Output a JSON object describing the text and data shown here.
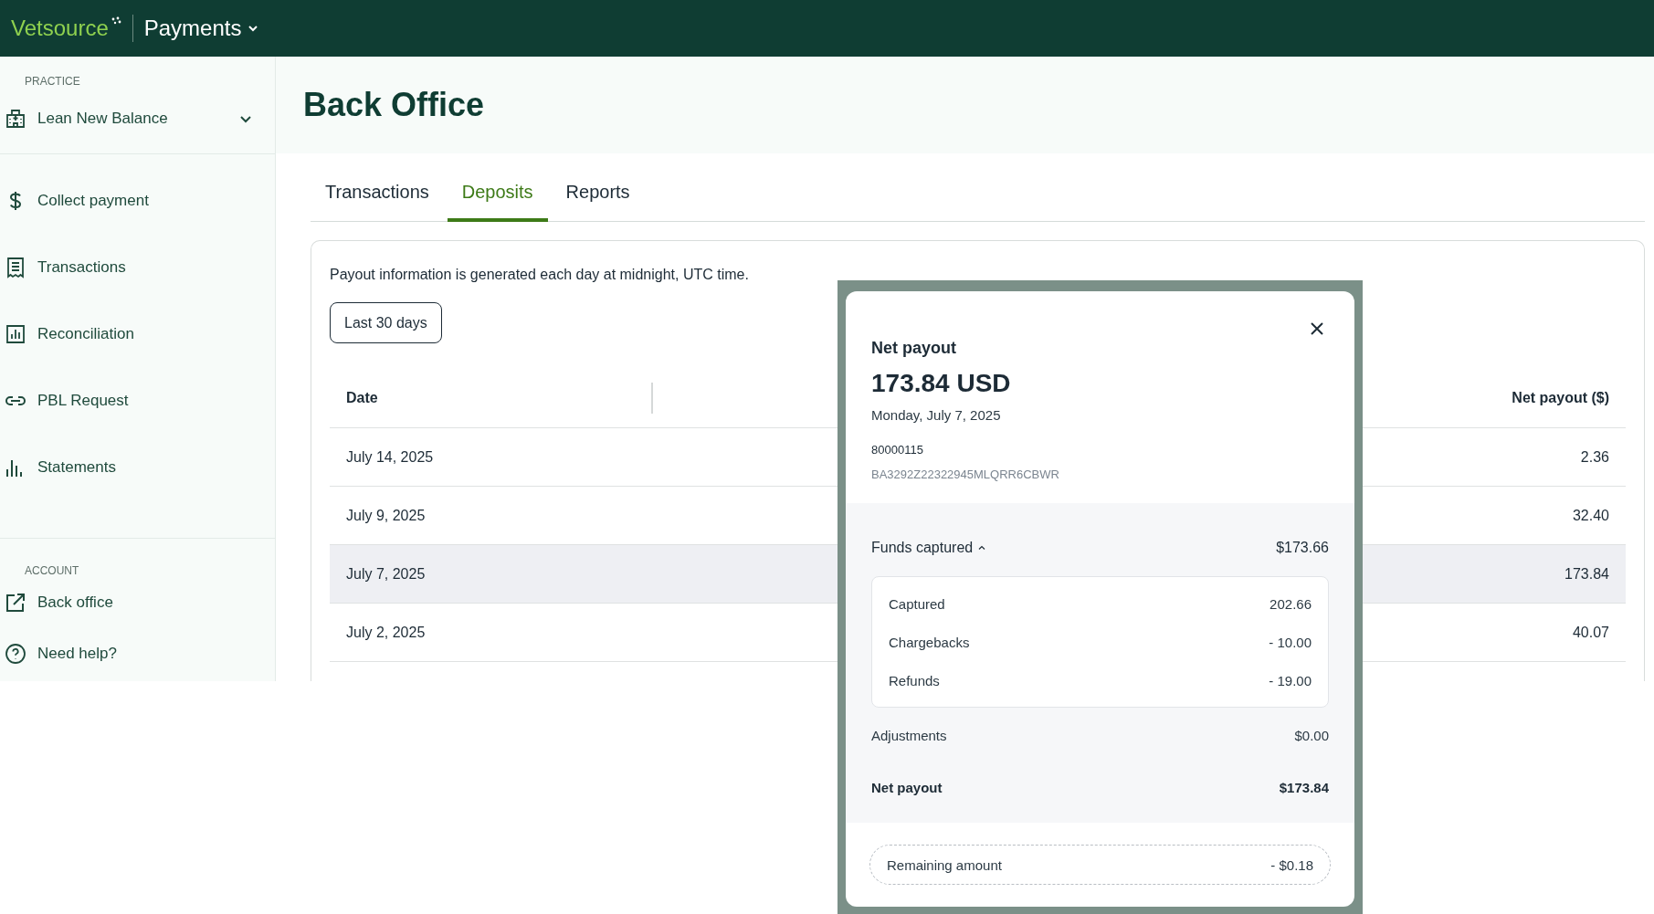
{
  "header": {
    "logo": "Vetsource",
    "app_switcher": "Payments"
  },
  "sidebar": {
    "practice_label": "PRACTICE",
    "practice_selector": "Lean New Balance",
    "nav_items": [
      {
        "label": "Collect payment"
      },
      {
        "label": "Transactions"
      },
      {
        "label": "Reconciliation"
      },
      {
        "label": "PBL Request"
      },
      {
        "label": "Statements"
      }
    ],
    "account_label": "ACCOUNT",
    "account_items": [
      {
        "label": "Back office"
      },
      {
        "label": "Need help?"
      }
    ]
  },
  "page_title": "Back Office",
  "tabs": [
    {
      "label": "Transactions",
      "selected": false
    },
    {
      "label": "Deposits",
      "selected": true
    },
    {
      "label": "Reports",
      "selected": false
    }
  ],
  "card": {
    "info_text": "Payout information is generated each day at midnight, UTC time.",
    "filter_button": "Last 30 days",
    "table": {
      "columns": [
        "Date",
        "Net payout ($)"
      ],
      "rows": [
        {
          "date": "July 14, 2025",
          "net_payout": "2.36",
          "highlighted": false
        },
        {
          "date": "July 9, 2025",
          "net_payout": "32.40",
          "highlighted": false
        },
        {
          "date": "July 7, 2025",
          "net_payout": "173.84",
          "highlighted": true
        },
        {
          "date": "July 2, 2025",
          "net_payout": "40.07",
          "highlighted": false
        }
      ]
    }
  },
  "modal": {
    "title": "Net payout",
    "amount": "173.84 USD",
    "date": "Monday, July 7, 2025",
    "reference": "80000115",
    "code": "BA3292Z22322945MLQRR6CBWR",
    "funds_captured": {
      "label": "Funds captured",
      "expanded": true,
      "total": "$173.66",
      "items": [
        {
          "label": "Captured",
          "value": "202.66"
        },
        {
          "label": "Chargebacks",
          "value": "- 10.00"
        },
        {
          "label": "Refunds",
          "value": "- 19.00"
        }
      ]
    },
    "adjustments": {
      "label": "Adjustments",
      "value": "$0.00"
    },
    "net_payout": {
      "label": "Net payout",
      "value": "$173.84"
    },
    "remaining": {
      "label": "Remaining amount",
      "value": "- $0.18"
    }
  }
}
